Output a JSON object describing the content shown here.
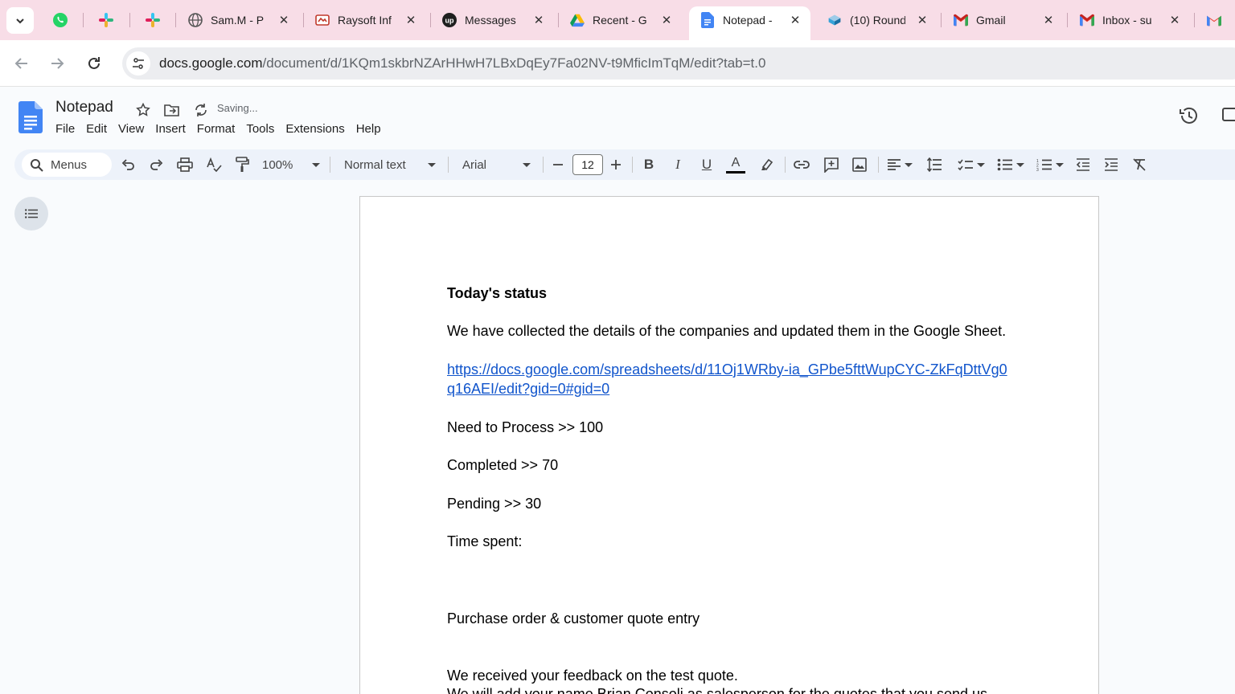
{
  "browser": {
    "tabs": [
      {
        "title": "Sam.M - P",
        "icon": "globe-icon"
      },
      {
        "title": "Raysoft Inf",
        "icon": "raysoft-favicon"
      },
      {
        "title": "Messages",
        "icon": "upwork-favicon"
      },
      {
        "title": "Recent - G",
        "icon": "google-drive-favicon"
      },
      {
        "title": "Notepad -",
        "icon": "google-docs-favicon",
        "active": true
      },
      {
        "title": "(10) Round",
        "icon": "roundcube-favicon"
      },
      {
        "title": "Gmail",
        "icon": "gmail-favicon"
      },
      {
        "title": "Inbox - su",
        "icon": "gmail-favicon"
      }
    ],
    "pinned": [
      "whatsapp-icon",
      "slack-icon",
      "slack-icon"
    ],
    "url_domain": "docs.google.com",
    "url_path": "/document/d/1KQm1skbrNZArHHwH7LBxDqEy7Fa02NV-t9MficImTqM/edit?tab=t.0"
  },
  "docs": {
    "title": "Notepad",
    "status": "Saving...",
    "menu": [
      "File",
      "Edit",
      "View",
      "Insert",
      "Format",
      "Tools",
      "Extensions",
      "Help"
    ],
    "toolbar": {
      "menus_search": "Menus",
      "zoom": "100%",
      "style": "Normal text",
      "font": "Arial",
      "font_size": "12"
    }
  },
  "document": {
    "heading": "Today's status",
    "p1": "We have collected the details of the companies and updated them in the Google Sheet.",
    "link": "https://docs.google.com/spreadsheets/d/11Oj1WRby-ia_GPbe5fttWupCYC-ZkFqDttVg0q16AEI/edit?gid=0#gid=0",
    "need": "Need to Process >> 100",
    "completed": "Completed >> 70",
    "pending": "Pending >> 30",
    "time": "Time spent:",
    "po": "Purchase order & customer quote entry",
    "feedback": "We received your feedback on the test quote.",
    "next": "We will add your name Brian Consoli as salesperson for the quotes that you send us."
  },
  "colors": {
    "tabstrip": "#f8dde7",
    "accent": "#1a73e8",
    "link": "#1155cc"
  }
}
